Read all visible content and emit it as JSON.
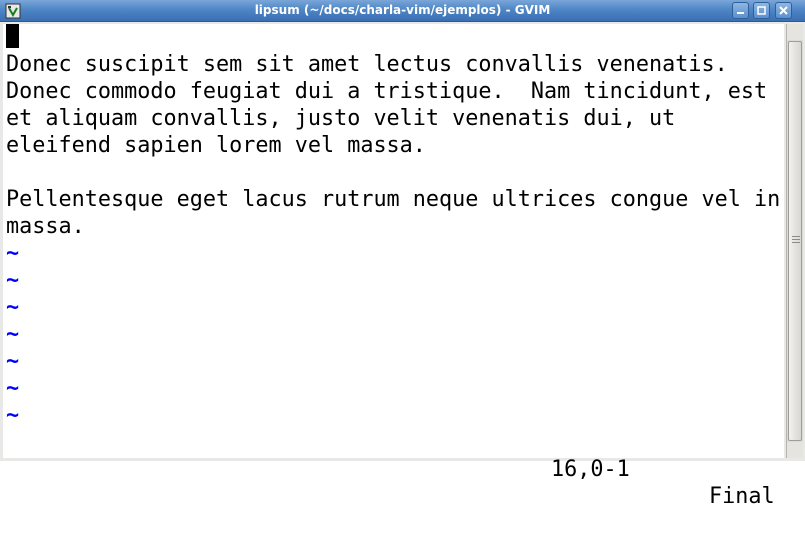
{
  "window": {
    "title": "lipsum (~/docs/charla-vim/ejemplos) - GVIM",
    "buttons": [
      "minimize",
      "maximize",
      "close"
    ]
  },
  "icons": {
    "app": "gvim-icon",
    "minimize": "minimize-icon",
    "maximize": "maximize-icon",
    "close": "close-icon"
  },
  "editor": {
    "lines": [
      "",
      "Donec suscipit sem sit amet lectus convallis venenatis.",
      "Donec commodo feugiat dui a tristique.  Nam tincidunt, est",
      "et aliquam convallis, justo velit venenatis dui, ut",
      "eleifend sapien lorem vel massa.",
      "",
      "Pellentesque eget lacus rutrum neque ultrices congue vel in",
      "massa."
    ],
    "tilde": "~",
    "tilde_count": 7
  },
  "statusline": {
    "ruler": "16,0-1",
    "position": "Final"
  },
  "colors": {
    "titlebar": "#4f86c6",
    "tilde": "#0000ff",
    "text": "#000000",
    "background": "#ffffff"
  }
}
